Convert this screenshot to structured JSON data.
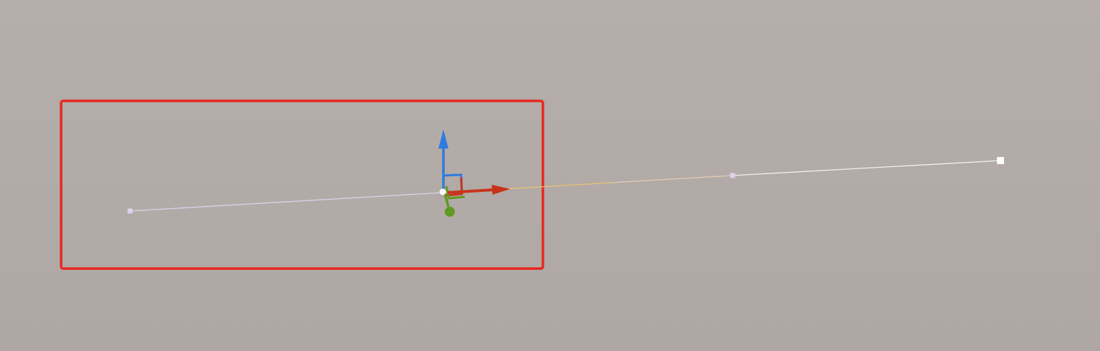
{
  "viewport": {
    "background_color": "#b2aba7"
  },
  "selection_box": {
    "color": "#e8271f"
  },
  "curve": {
    "segment_colors": {
      "selected": "#dcd2ec",
      "transition": "#e8c27a",
      "unselected": "#f2f0ee"
    },
    "control_points": [
      {
        "name": "curve-control-point-start",
        "selected": true
      },
      {
        "name": "curve-control-point-origin",
        "selected": true
      },
      {
        "name": "curve-control-point-mid",
        "selected": true
      },
      {
        "name": "curve-control-point-end",
        "selected": false
      }
    ]
  },
  "gizmo": {
    "type": "move",
    "axis_colors": {
      "x": "#c8341b",
      "y": "#5d9a1f",
      "z": "#2f7be0"
    },
    "icons": {
      "x": "arrow-right-icon",
      "y": "arrow-forward-icon",
      "z": "arrow-up-icon"
    }
  }
}
